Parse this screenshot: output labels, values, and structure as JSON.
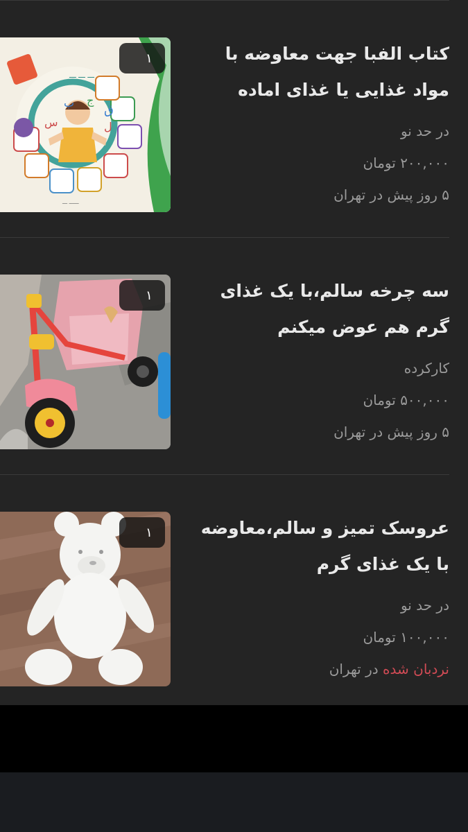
{
  "colors": {
    "feed_background": "#242424",
    "title_text": "#e9e9e9",
    "meta_text": "#9b9b9b",
    "ladder_accent": "#d14b55",
    "divider": "#3a3a3a",
    "page_background": "#000000",
    "nav_background": "#1a1c20"
  },
  "posts": [
    {
      "title": "کتاب الفبا جهت معاوضه با مواد غذایی یا غذای اماده",
      "condition": "در حد نو",
      "price": "۲۰۰,۰۰۰ تومان",
      "time_location": "۵ روز پیش در تهران",
      "image_count": "۱",
      "image": "alphabet-book-photo"
    },
    {
      "title": "سه چرخه سالم،با یک غذای گرم هم عوض میکنم",
      "condition": "کارکرده",
      "price": "۵۰۰,۰۰۰ تومان",
      "time_location": "۵ روز پیش در تهران",
      "image_count": "۱",
      "image": "tricycle-photo"
    },
    {
      "title": "عروسک تمیز و سالم،معاوضه با یک غذای گرم",
      "condition": "در حد نو",
      "price": "۱۰۰,۰۰۰ تومان",
      "ladder_label": "نردبان شده",
      "location_suffix": "در تهران",
      "image_count": "۱",
      "image": "teddy-bear-photo"
    }
  ]
}
